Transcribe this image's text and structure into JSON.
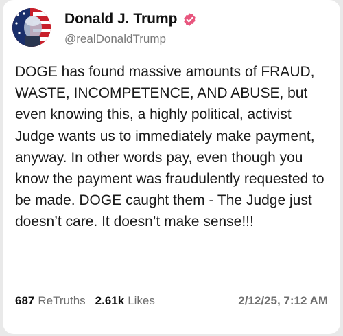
{
  "author": {
    "display_name": "Donald J. Trump",
    "handle": "@realDonaldTrump",
    "verified_badge_color": "#e8567e"
  },
  "post": {
    "text": "DOGE has found massive amounts of FRAUD, WASTE, INCOMPETENCE, AND ABUSE, but even knowing this, a highly political, activist Judge wants us to immediately make payment, anyway. In other words pay, even though you know the payment was fraudulently requested to be made. DOGE caught them - The Judge just doesn’t care. It doesn’t make sense!!!"
  },
  "stats": {
    "retruths_count": "687",
    "retruths_label": "ReTruths",
    "likes_count": "2.61k",
    "likes_label": "Likes",
    "timestamp": "2/12/25, 7:12 AM"
  },
  "colors": {
    "background": "#e9e9e9",
    "card": "#ffffff",
    "text": "#1a1a1a",
    "muted": "#6f6f6f"
  }
}
